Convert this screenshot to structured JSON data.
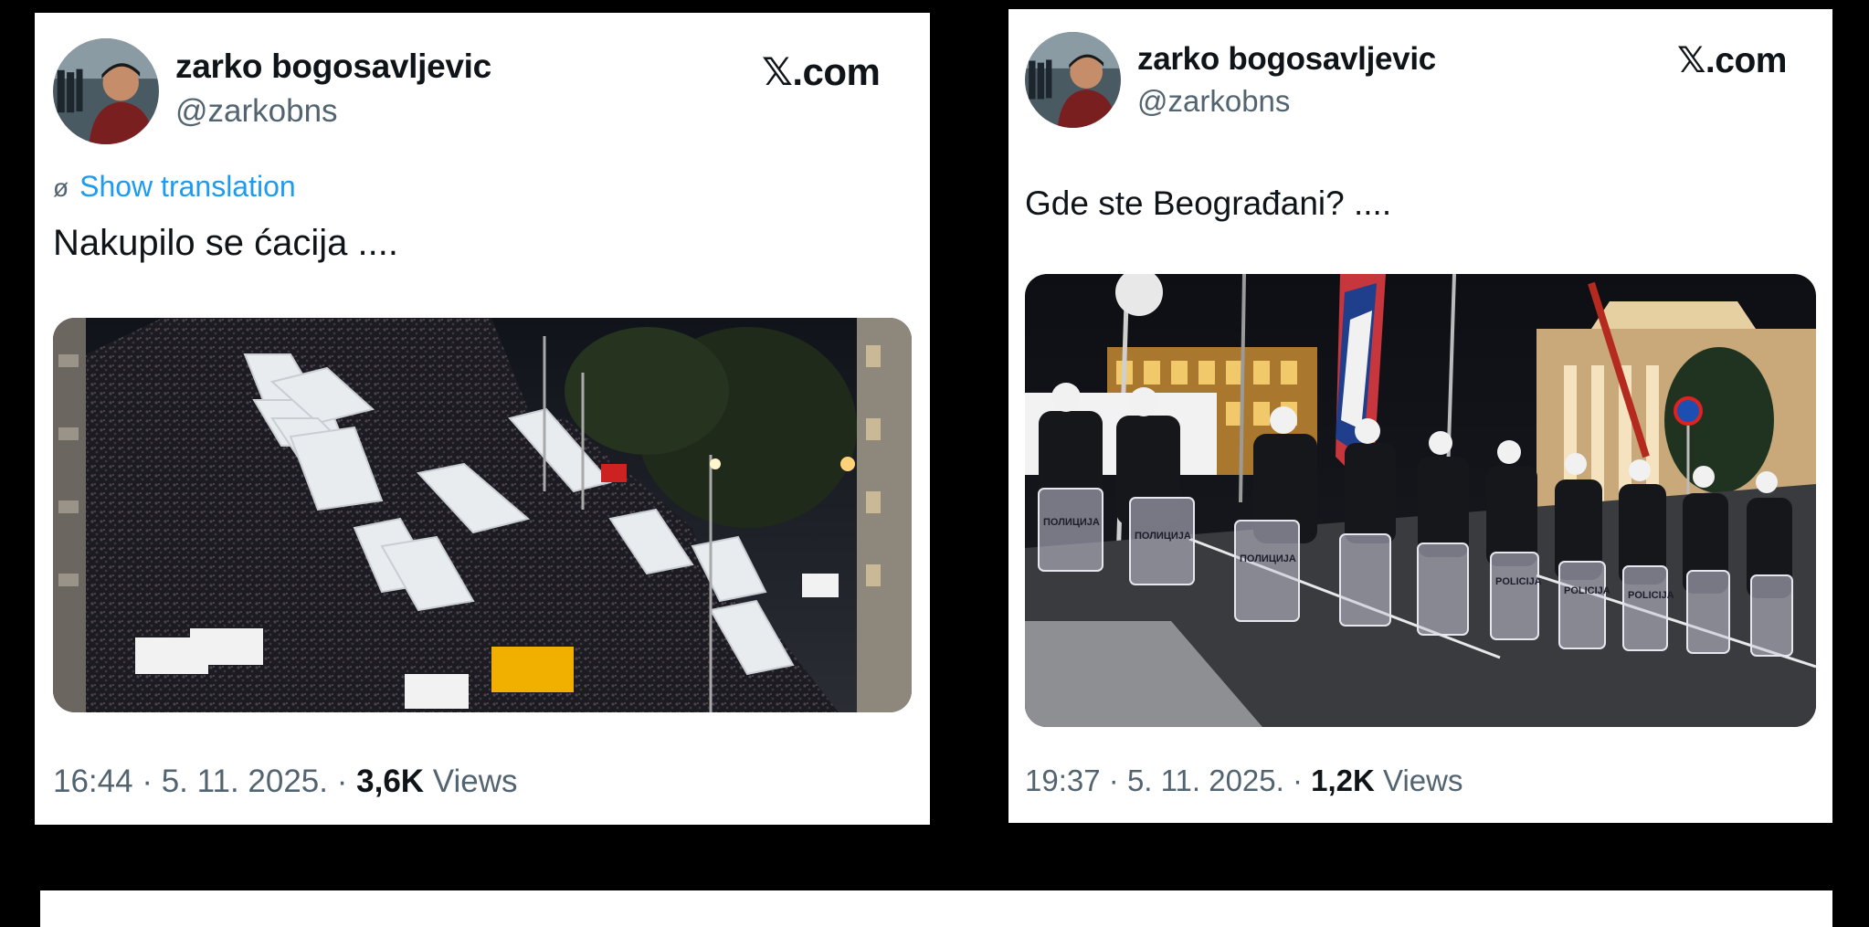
{
  "tweets": [
    {
      "author_name": "zarko bogosavljevic",
      "author_handle": "@zarkobns",
      "site_logo": "𝕏.com",
      "translate_label": "Show translation",
      "text": "Nakupilo se ćacija ....",
      "time": "16:44",
      "date": "5. 11. 2025.",
      "separator": "·",
      "views_count": "3,6K",
      "views_label": "Views"
    },
    {
      "author_name": "zarko bogosavljevic",
      "author_handle": "@zarkobns",
      "site_logo": "𝕏.com",
      "text": "Gde ste Beograđani? ....",
      "time": "19:37",
      "date": "5. 11. 2025.",
      "separator": "·",
      "views_count": "1,2K",
      "views_label": "Views"
    }
  ],
  "icons": {
    "translate": "globe-slash-icon",
    "logo": "x-logo-icon"
  },
  "photo_text": {
    "shield_label_cyrillic": "ПОЛИЦИЈА",
    "shield_label_latin": "POLICIJA"
  },
  "colors": {
    "background": "#000000",
    "card": "#ffffff",
    "link_blue": "#1d9bf0",
    "secondary_text": "#536471"
  }
}
